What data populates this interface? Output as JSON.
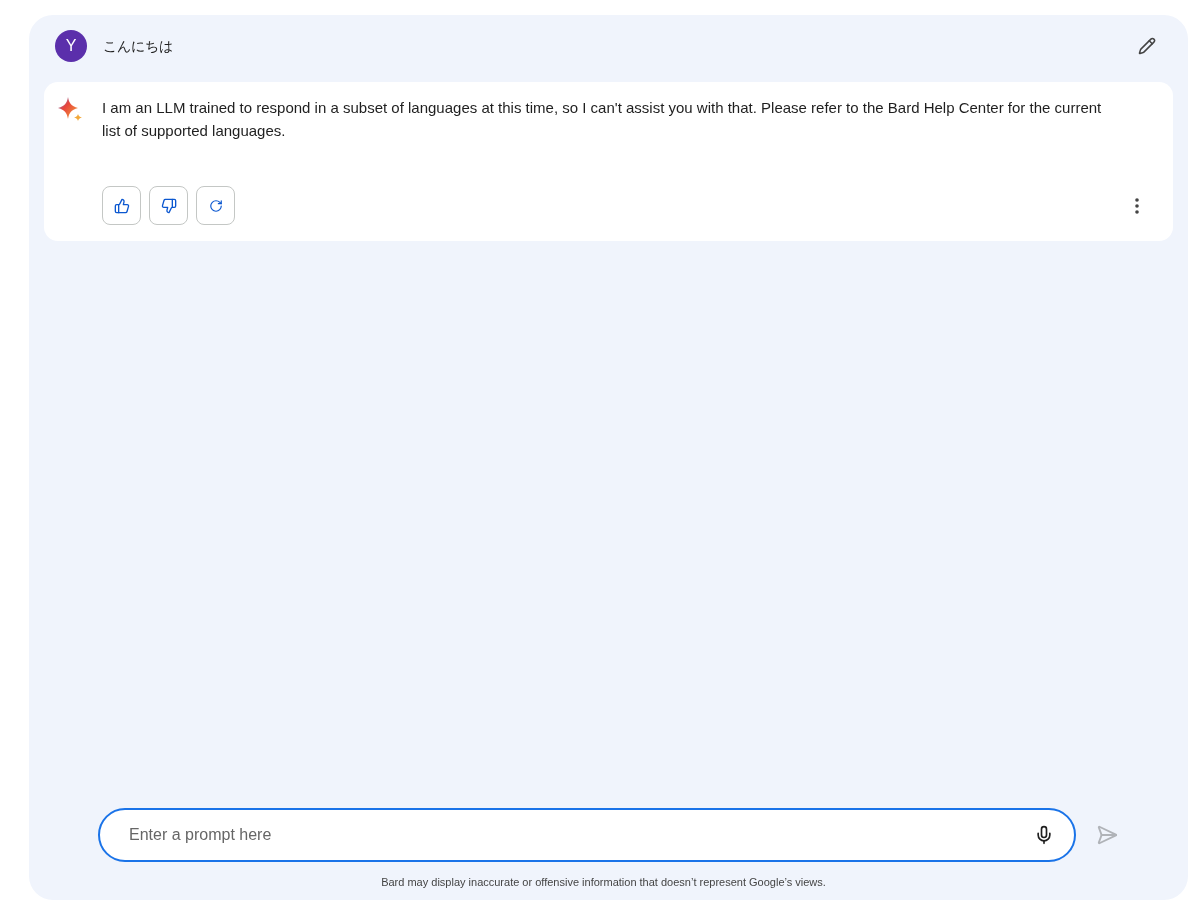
{
  "user_message": {
    "avatar_letter": "Y",
    "text": "こんにちは"
  },
  "response": {
    "text": "I am an LLM trained to respond in a subset of languages at this time, so I can't assist you with that. Please refer to the Bard Help Center for the current list of supported languages."
  },
  "prompt": {
    "placeholder": "Enter a prompt here"
  },
  "send_button": {
    "disabled": true
  },
  "disclaimer": "Bard may display inaccurate or offensive information that doesn’t represent Google’s views."
}
